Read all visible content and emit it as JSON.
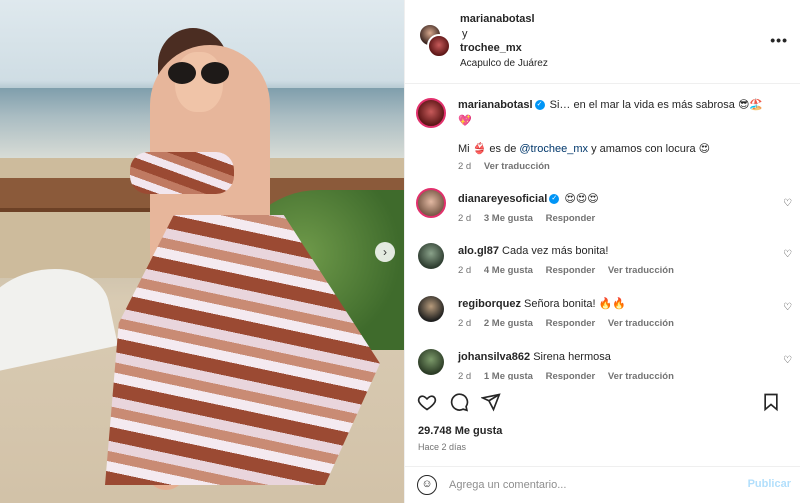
{
  "header": {
    "user1": "marianabotasl",
    "joiner": "y",
    "user2": "trochee_mx",
    "location": "Acapulco de Juárez",
    "more_label": "•••"
  },
  "caption": {
    "username": "marianabotasl",
    "text_line1": "Si… en el mar la vida es más sabrosa 😎🏖️",
    "text_line1b": "💖",
    "text_line2_pre": "Mi 👙 es de ",
    "text_line2_mention": "@trochee_mx",
    "text_line2_post": " y amamos con locura 😍",
    "time": "2 d",
    "translate": "Ver traducción"
  },
  "comments": [
    {
      "username": "dianareyesoficial",
      "verified": true,
      "text": "😍😍😍",
      "time": "2 d",
      "likes": "3 Me gusta",
      "reply": "Responder",
      "translate": ""
    },
    {
      "username": "alo.gl87",
      "verified": false,
      "text": "Cada vez más bonita!",
      "time": "2 d",
      "likes": "4 Me gusta",
      "reply": "Responder",
      "translate": "Ver traducción"
    },
    {
      "username": "regiborquez",
      "verified": false,
      "text": "Señora bonita! 🔥🔥",
      "time": "2 d",
      "likes": "2 Me gusta",
      "reply": "Responder",
      "translate": "Ver traducción"
    },
    {
      "username": "johansilva862",
      "verified": false,
      "text": "Sirena hermosa",
      "time": "2 d",
      "likes": "1 Me gusta",
      "reply": "Responder",
      "translate": "Ver traducción"
    }
  ],
  "stats": {
    "likes": "29.748 Me gusta",
    "ago": "Hace 2 días"
  },
  "composer": {
    "placeholder": "Agrega un comentario...",
    "post_label": "Publicar"
  },
  "icons": {
    "like": "heart-icon",
    "comment": "comment-icon",
    "share": "share-icon",
    "save": "bookmark-icon",
    "next": "chevron-right-icon"
  },
  "colors": {
    "link": "#00376b",
    "verified": "#0095f6",
    "post_disabled": "#b2dffc",
    "muted": "#737373"
  }
}
